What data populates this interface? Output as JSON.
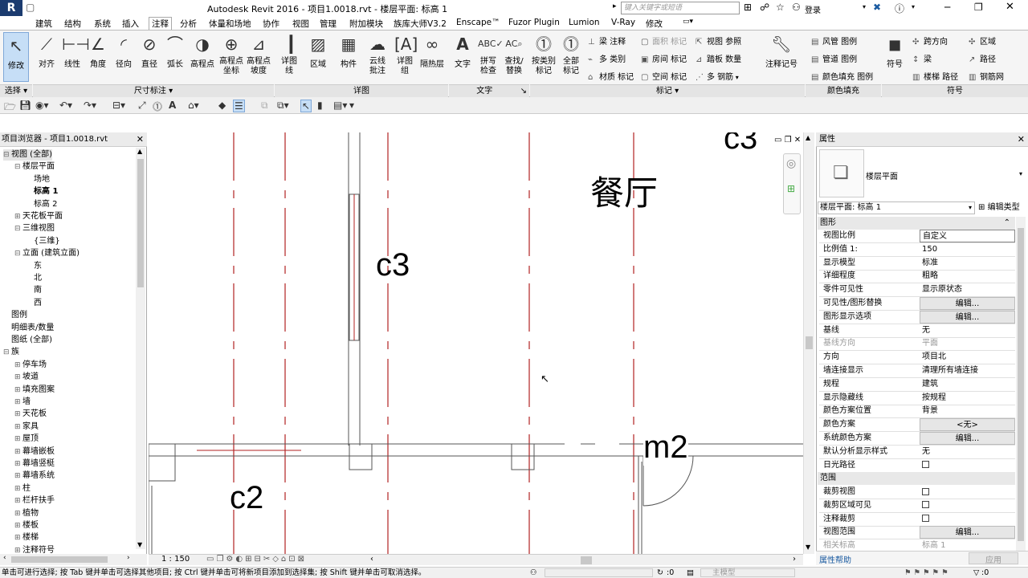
{
  "app": {
    "title": "Autodesk Revit 2016 -    项目1.0018.rvt - 楼层平面: 标高 1",
    "logo": "R",
    "search_placeholder": "键入关键字或短语",
    "login": "登录"
  },
  "tabs": [
    "建筑",
    "结构",
    "系统",
    "插入",
    "注释",
    "分析",
    "体量和场地",
    "协作",
    "视图",
    "管理",
    "附加模块",
    "族库大师V3.2",
    "Enscape™",
    "Fuzor Plugin",
    "Lumion",
    "V-Ray",
    "修改"
  ],
  "active_tab": "注释",
  "ribbon": {
    "modify": "修改",
    "select_panel": "选择",
    "dimension_tools": [
      "对齐",
      "线性",
      "角度",
      "径向",
      "直径",
      "弧长",
      "高程点",
      "高程点\n坐标",
      "高程点\n坡度"
    ],
    "dimension_panel": "尺寸标注",
    "detail_tools": [
      "详图\n线",
      "区域",
      "构件",
      "云线\n批注",
      "详图\n组",
      "隔热层"
    ],
    "detail_panel": "详图",
    "text_tools": [
      "文字",
      "拼写\n检查",
      "查找/\n替换"
    ],
    "text_panel": "文字",
    "tag_tools": [
      "按类别\n标记",
      "全部\n标记"
    ],
    "tag_small": [
      "梁 注释",
      "多 类别",
      "材质 标记",
      "面积 标记",
      "房间 标记",
      "空间 标记",
      "视图 参照",
      "踏板 数量",
      "多 钢筋"
    ],
    "keynote": "注释记号",
    "tag_panel": "标记",
    "color_fill": [
      "风管 图例",
      "管道 图例",
      "颜色填充 图例"
    ],
    "color_fill_panel": "颜色填充",
    "symbol_tools": [
      "符号"
    ],
    "symbol_small": [
      "跨方向",
      "梁",
      "楼梯 路径",
      "区域",
      "路径",
      "钢筋网"
    ],
    "symbol_panel": "符号"
  },
  "project_browser": {
    "title": "项目浏览器 - 项目1.0018.rvt",
    "items": [
      {
        "label": "视图 (全部)",
        "level": 0,
        "expander": "⊟"
      },
      {
        "label": "楼层平面",
        "level": 1,
        "expander": "⊟"
      },
      {
        "label": "场地",
        "level": 2,
        "expander": ""
      },
      {
        "label": "标高 1",
        "level": 2,
        "expander": "",
        "bold": true
      },
      {
        "label": "标高 2",
        "level": 2,
        "expander": ""
      },
      {
        "label": "天花板平面",
        "level": 1,
        "expander": "⊞"
      },
      {
        "label": "三维视图",
        "level": 1,
        "expander": "⊟"
      },
      {
        "label": "{三维}",
        "level": 2,
        "expander": ""
      },
      {
        "label": "立面 (建筑立面)",
        "level": 1,
        "expander": "⊟"
      },
      {
        "label": "东",
        "level": 2,
        "expander": ""
      },
      {
        "label": "北",
        "level": 2,
        "expander": ""
      },
      {
        "label": "南",
        "level": 2,
        "expander": ""
      },
      {
        "label": "西",
        "level": 2,
        "expander": ""
      },
      {
        "label": "图例",
        "level": 0,
        "expander": ""
      },
      {
        "label": "明细表/数量",
        "level": 0,
        "expander": ""
      },
      {
        "label": "图纸 (全部)",
        "level": 0,
        "expander": ""
      },
      {
        "label": "族",
        "level": 0,
        "expander": "⊟"
      },
      {
        "label": "停车场",
        "level": 1,
        "expander": "⊞"
      },
      {
        "label": "坡道",
        "level": 1,
        "expander": "⊞"
      },
      {
        "label": "填充图案",
        "level": 1,
        "expander": "⊞"
      },
      {
        "label": "墙",
        "level": 1,
        "expander": "⊞"
      },
      {
        "label": "天花板",
        "level": 1,
        "expander": "⊞"
      },
      {
        "label": "家具",
        "level": 1,
        "expander": "⊞"
      },
      {
        "label": "屋顶",
        "level": 1,
        "expander": "⊞"
      },
      {
        "label": "幕墙嵌板",
        "level": 1,
        "expander": "⊞"
      },
      {
        "label": "幕墙竖梃",
        "level": 1,
        "expander": "⊞"
      },
      {
        "label": "幕墙系统",
        "level": 1,
        "expander": "⊞"
      },
      {
        "label": "柱",
        "level": 1,
        "expander": "⊞"
      },
      {
        "label": "栏杆扶手",
        "level": 1,
        "expander": "⊞"
      },
      {
        "label": "植物",
        "level": 1,
        "expander": "⊞"
      },
      {
        "label": "楼板",
        "level": 1,
        "expander": "⊞"
      },
      {
        "label": "楼梯",
        "level": 1,
        "expander": "⊞"
      },
      {
        "label": "注释符号",
        "level": 1,
        "expander": "⊞"
      }
    ]
  },
  "drawing": {
    "labels": {
      "c3_top": "c3",
      "c3": "c3",
      "c2": "c2",
      "m2": "m2",
      "room": "餐厅"
    },
    "scale": "1 : 150"
  },
  "properties": {
    "title": "属性",
    "type_name": "楼层平面",
    "selector": "楼层平面: 标高 1",
    "edit_type": "编辑类型",
    "section_graphics": "图形",
    "rows": [
      {
        "k": "视图比例",
        "v": "自定义",
        "style": "input"
      },
      {
        "k": "比例值 1:",
        "v": "150"
      },
      {
        "k": "显示模型",
        "v": "标准"
      },
      {
        "k": "详细程度",
        "v": "粗略"
      },
      {
        "k": "零件可见性",
        "v": "显示原状态"
      },
      {
        "k": "可见性/图形替换",
        "v": "编辑...",
        "style": "btn"
      },
      {
        "k": "图形显示选项",
        "v": "编辑...",
        "style": "btn"
      },
      {
        "k": "基线",
        "v": "无"
      },
      {
        "k": "基线方向",
        "v": "平面",
        "style": "dis"
      },
      {
        "k": "方向",
        "v": "项目北"
      },
      {
        "k": "墙连接显示",
        "v": "清理所有墙连接"
      },
      {
        "k": "规程",
        "v": "建筑"
      },
      {
        "k": "显示隐藏线",
        "v": "按规程"
      },
      {
        "k": "颜色方案位置",
        "v": "背景"
      },
      {
        "k": "颜色方案",
        "v": "<无>",
        "style": "btn"
      },
      {
        "k": "系统颜色方案",
        "v": "编辑...",
        "style": "btn"
      },
      {
        "k": "默认分析显示样式",
        "v": "无"
      },
      {
        "k": "日光路径",
        "v": "",
        "style": "check"
      }
    ],
    "section_extents": "范围",
    "rows2": [
      {
        "k": "裁剪视图",
        "v": "",
        "style": "check"
      },
      {
        "k": "裁剪区域可见",
        "v": "",
        "style": "check"
      },
      {
        "k": "注释裁剪",
        "v": "",
        "style": "check"
      },
      {
        "k": "视图范围",
        "v": "编辑...",
        "style": "btn"
      },
      {
        "k": "相关标高",
        "v": "标高 1",
        "style": "dis"
      }
    ],
    "help": "属性帮助",
    "apply": "应用"
  },
  "status": {
    "text": "单击可进行选择; 按 Tab 键并单击可选择其他项目; 按 Ctrl 键并单击可将新项目添加到选择集; 按 Shift 键并单击可取消选择。",
    "zero": ":0",
    "model": "主模型",
    "filter": ":0"
  }
}
